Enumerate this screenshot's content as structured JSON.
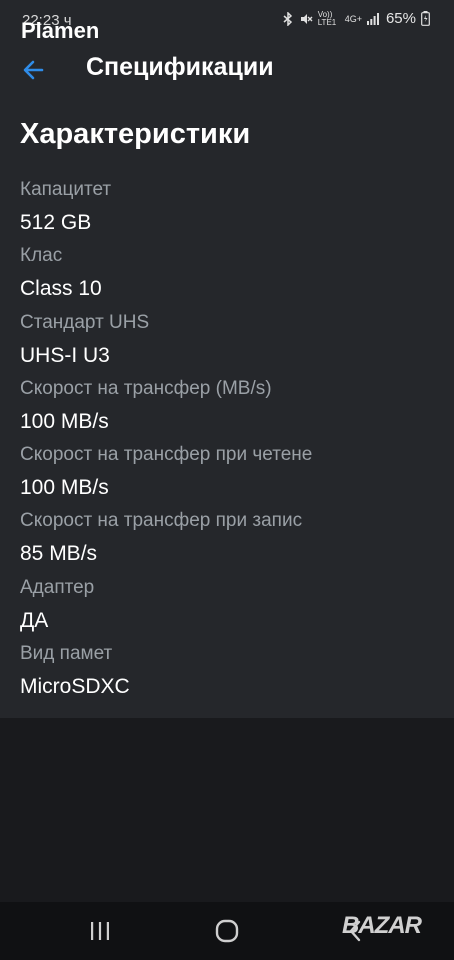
{
  "status": {
    "time": "22:23 ч",
    "owner": "Plamen",
    "volte": "Vo)) LTE1",
    "network": "4G+",
    "battery": "65%"
  },
  "appbar": {
    "title": "Спецификации",
    "back_icon": "arrow-left-icon",
    "accent": "#2f8ce8"
  },
  "section": {
    "title": "Характеристики"
  },
  "specs": [
    {
      "label": "Капацитет",
      "value": "512 GB"
    },
    {
      "label": "Клас",
      "value": "Class 10"
    },
    {
      "label": "Стандарт UHS",
      "value": "UHS-I U3"
    },
    {
      "label": "Скорост на трансфер (MB/s)",
      "value": "100 MB/s"
    },
    {
      "label": "Скорост на трансфер при четене",
      "value": "100 MB/s"
    },
    {
      "label": "Скорост на трансфер при запис",
      "value": "85 MB/s"
    },
    {
      "label": "Адаптер",
      "value": "ДА"
    },
    {
      "label": "Вид памет",
      "value": "MicroSDXC"
    }
  ],
  "watermark": "BAZAR"
}
